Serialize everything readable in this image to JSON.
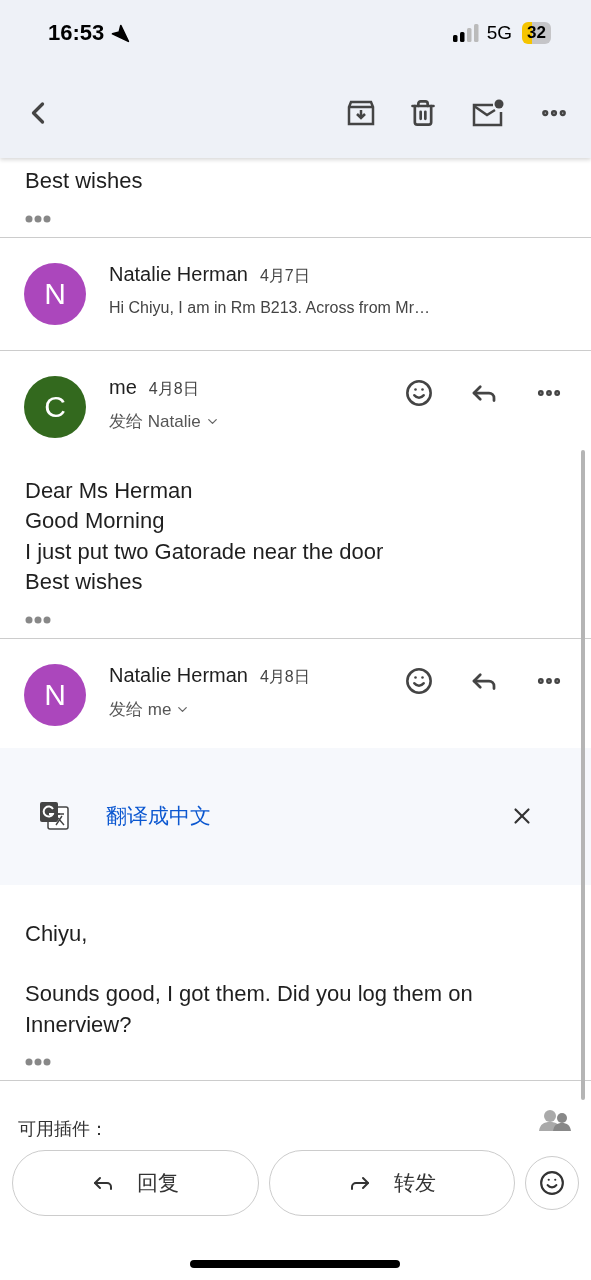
{
  "status_bar": {
    "time": "16:53",
    "network": "5G",
    "battery": "32"
  },
  "messages": [
    {
      "kind": "partial",
      "body": [
        "Best wishes"
      ]
    },
    {
      "kind": "collapsed",
      "avatar": "N",
      "color": "#ab47bc",
      "sender": "Natalie Herman",
      "date": "4月7日",
      "snippet": "Hi Chiyu, I am in Rm B213. Across from Mr…"
    },
    {
      "kind": "expanded",
      "avatar": "C",
      "color": "#33691e",
      "sender": "me",
      "date": "4月8日",
      "recipient": "发给 Natalie",
      "body": [
        "Dear Ms Herman",
        "Good Morning",
        "I just put two Gatorade near the door",
        "Best wishes"
      ]
    },
    {
      "kind": "expanded",
      "avatar": "N",
      "color": "#ab47bc",
      "sender": "Natalie Herman",
      "date": "4月8日",
      "recipient": "发给 me",
      "translate": "翻译成中文",
      "paragraphs": [
        "Chiyu,",
        "Sounds good, I got them. Did you log them on Innerview?"
      ]
    }
  ],
  "addons_label": "可用插件：",
  "actions": [
    {
      "kind": "reply",
      "label": "回复"
    },
    {
      "kind": "forward",
      "label": "转发"
    }
  ]
}
